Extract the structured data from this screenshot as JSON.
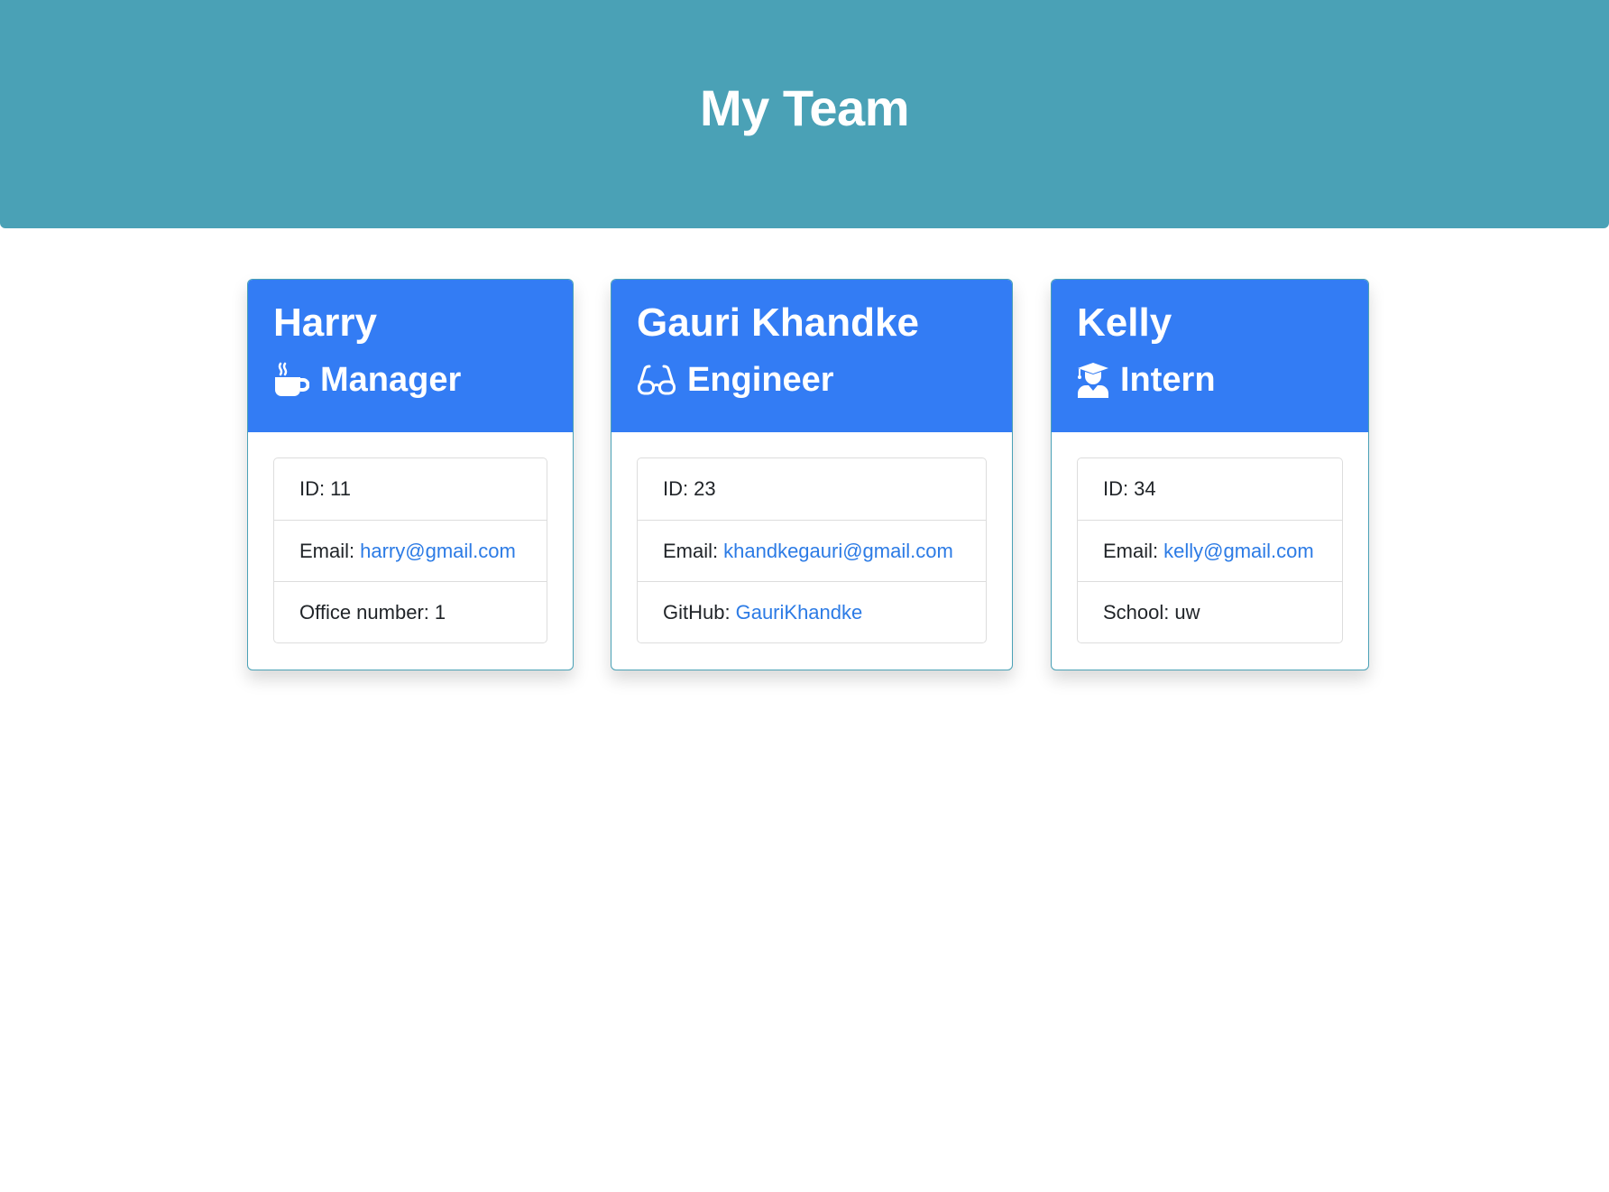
{
  "header": {
    "title": "My Team",
    "background_color": "#4aa1b6"
  },
  "colors": {
    "card_header": "#337cf4",
    "link": "#2c7be5"
  },
  "team": [
    {
      "name": "Harry",
      "role": "Manager",
      "role_icon": "coffee-mug-icon",
      "id_label": "ID:",
      "id": "11",
      "email_label": "Email:",
      "email": "harry@gmail.com",
      "extra_label": "Office number:",
      "extra_value": "1"
    },
    {
      "name": "Gauri Khandke",
      "role": "Engineer",
      "role_icon": "glasses-icon",
      "id_label": "ID:",
      "id": "23",
      "email_label": "Email:",
      "email": "khandkegauri@gmail.com",
      "extra_label": "GitHub:",
      "extra_value": "GauriKhandke"
    },
    {
      "name": "Kelly",
      "role": "Intern",
      "role_icon": "graduate-icon",
      "id_label": "ID:",
      "id": "34",
      "email_label": "Email:",
      "email": "kelly@gmail.com",
      "extra_label": "School:",
      "extra_value": "uw"
    }
  ]
}
